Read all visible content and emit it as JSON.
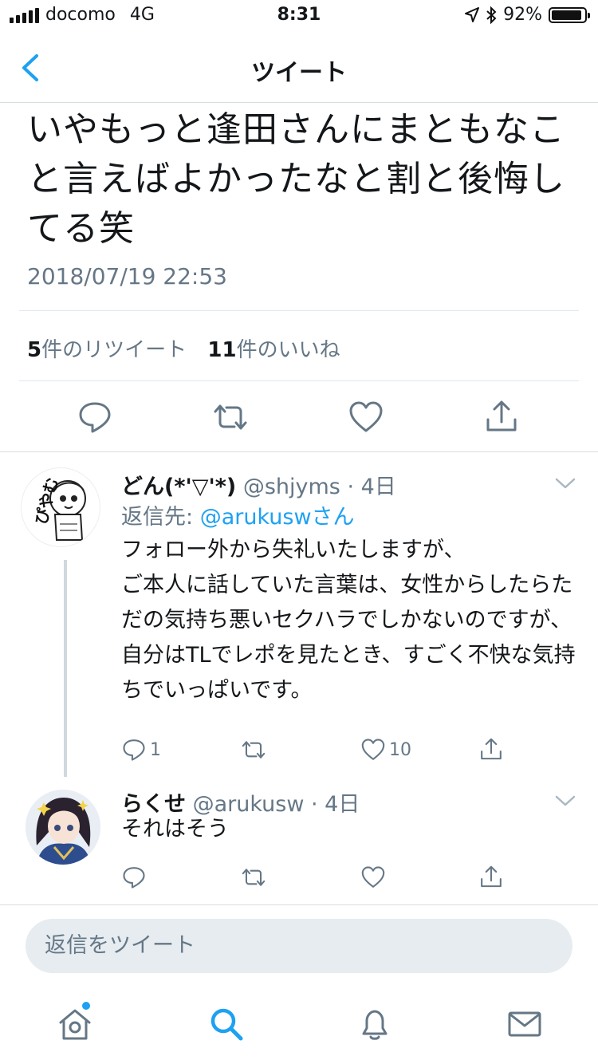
{
  "status_bar": {
    "carrier": "docomo",
    "network": "4G",
    "time": "8:31",
    "battery_text": "92%",
    "battery_level": 0.92
  },
  "nav": {
    "title": "ツイート"
  },
  "tweet": {
    "text": "いやもっと逢田さんにまともなこと言えばよかったなと割と後悔してる笑",
    "datetime": "2018/07/19 22:53",
    "retweet_count": "5",
    "retweet_label": "件のリツイート",
    "like_count": "11",
    "like_label": "件のいいね"
  },
  "replies": [
    {
      "name": "どん(*'▽'*)",
      "handle": "@shjyms",
      "time": "· 4日",
      "reply_to_prefix": "返信先:",
      "reply_to_user": "@aruku­swさん",
      "body": "フォロー外から失礼いたしますが、\nご本人に話していた言葉は、女性からしたらただの気持ち悪いセクハラでしかないのですが、\n自分はTLでレポを見たとき、すごく不快な気持ちでいっぱいです。",
      "reply_count": "1",
      "like_count": "10",
      "avatar_text": "ぴやむ"
    },
    {
      "name": "らくせ",
      "handle": "@arukusw",
      "time": "· 4日",
      "body": "それはそう"
    }
  ],
  "compose": {
    "placeholder": "返信をツイート"
  },
  "icons": {
    "back": "chevron-left-icon",
    "reply": "reply-icon",
    "retweet": "retweet-icon",
    "like": "heart-icon",
    "share": "share-icon",
    "home": "home-icon",
    "search": "search-icon",
    "notifications": "bell-icon",
    "messages": "mail-icon"
  },
  "colors": {
    "accent": "#1da1f2",
    "secondary_text": "#657786",
    "divider": "#e1e8ed"
  }
}
